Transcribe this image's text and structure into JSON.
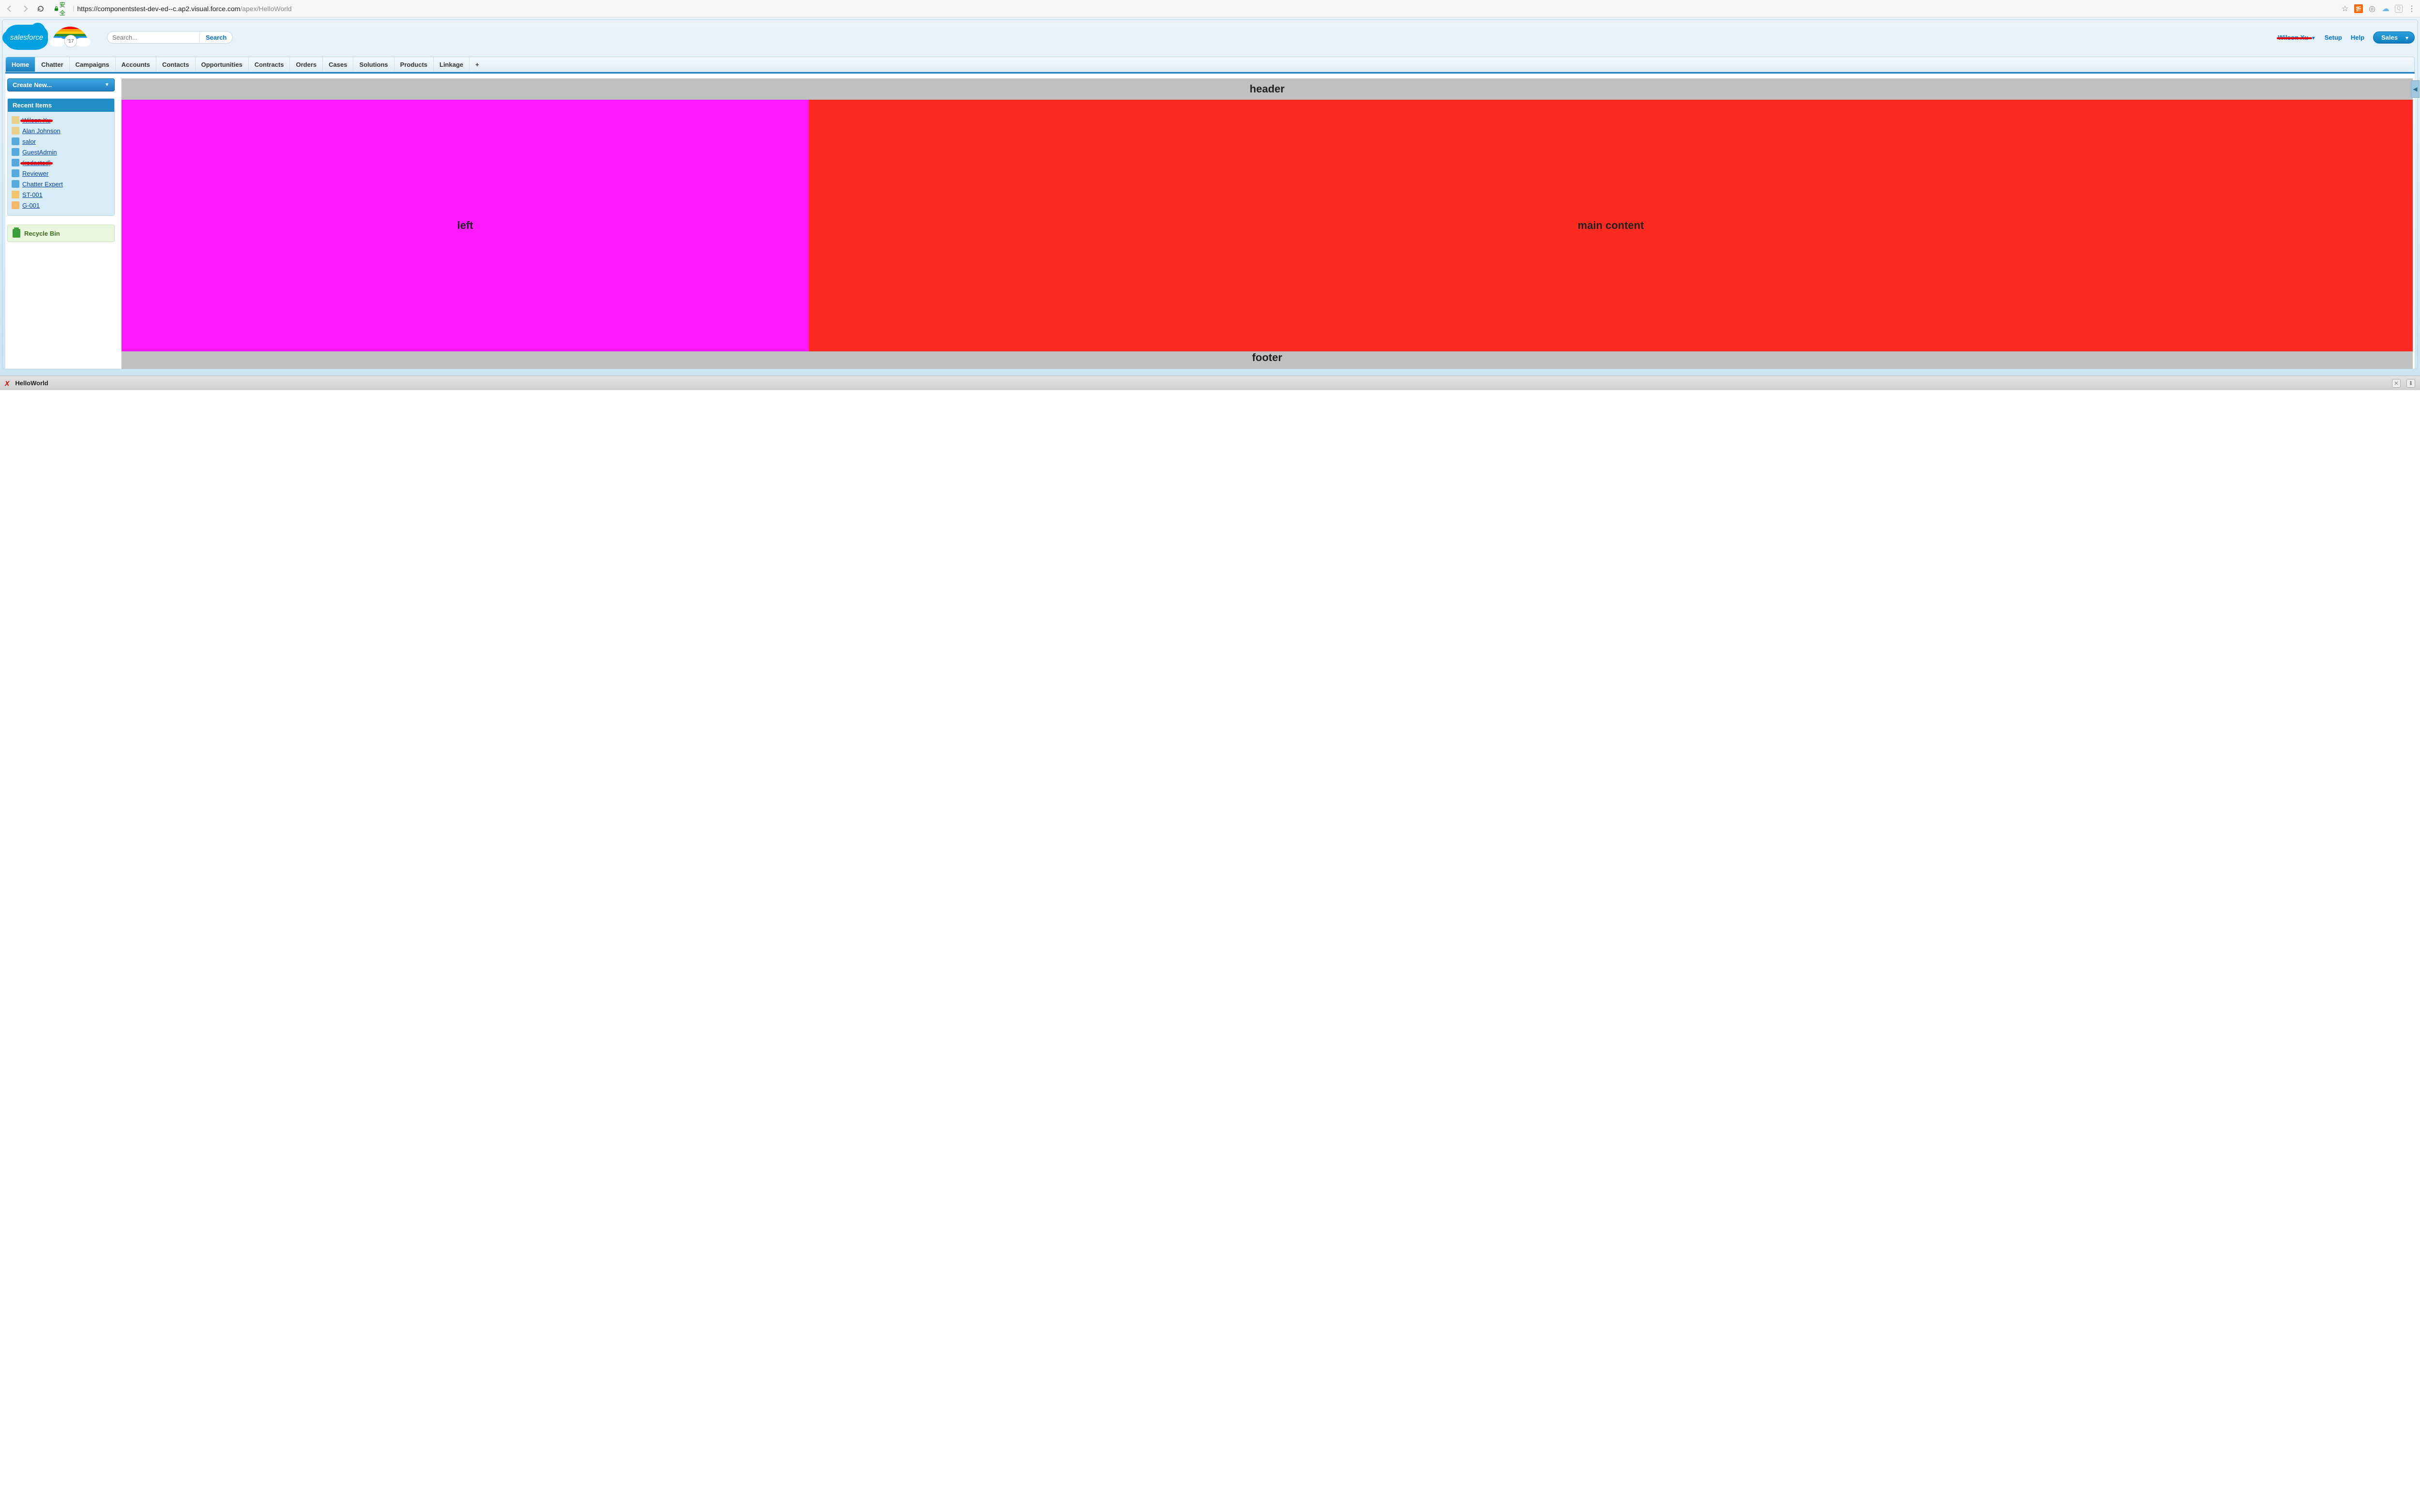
{
  "browser": {
    "secure_label": "安全",
    "url_dark": "https://componentstest-dev-ed--c.ap2.visual.force.com",
    "url_grey": "/apex/HelloWorld"
  },
  "header": {
    "logo_text": "salesforce",
    "rainbow_badge": "'17",
    "search_placeholder": "Search...",
    "search_button": "Search",
    "user_name": "Wilson Xu",
    "setup": "Setup",
    "help": "Help",
    "app_switcher": "Sales"
  },
  "tabs": [
    {
      "label": "Home",
      "active": true
    },
    {
      "label": "Chatter",
      "active": false
    },
    {
      "label": "Campaigns",
      "active": false
    },
    {
      "label": "Accounts",
      "active": false
    },
    {
      "label": "Contacts",
      "active": false
    },
    {
      "label": "Opportunities",
      "active": false
    },
    {
      "label": "Contracts",
      "active": false
    },
    {
      "label": "Orders",
      "active": false
    },
    {
      "label": "Cases",
      "active": false
    },
    {
      "label": "Solutions",
      "active": false
    },
    {
      "label": "Products",
      "active": false
    },
    {
      "label": "Linkage",
      "active": false
    }
  ],
  "sidebar": {
    "create_new": "Create New...",
    "recent_header": "Recent Items",
    "recent_items": [
      {
        "label": "Wilson Xu",
        "icon": "contact",
        "redacted": true
      },
      {
        "label": "Alan Johnson",
        "icon": "contact",
        "redacted": false
      },
      {
        "label": "salor",
        "icon": "person",
        "redacted": false
      },
      {
        "label": "GuestAdmin",
        "icon": "person",
        "redacted": false
      },
      {
        "label": "(redacted)",
        "icon": "person",
        "redacted": true
      },
      {
        "label": "Reviewer",
        "icon": "person",
        "redacted": false
      },
      {
        "label": "Chatter Expert",
        "icon": "person",
        "redacted": false
      },
      {
        "label": "ST-001",
        "icon": "note",
        "redacted": false
      },
      {
        "label": "G-001",
        "icon": "pencil",
        "redacted": false
      }
    ],
    "recycle_bin": "Recycle Bin"
  },
  "vf": {
    "header": "header",
    "left": "left",
    "main": "main content",
    "footer": "footer"
  },
  "devfooter": {
    "title": "HelloWorld"
  },
  "colors": {
    "header_bg": "#c0c0c0",
    "left_bg": "#ff19ff",
    "main_bg": "#ff2a1f"
  }
}
